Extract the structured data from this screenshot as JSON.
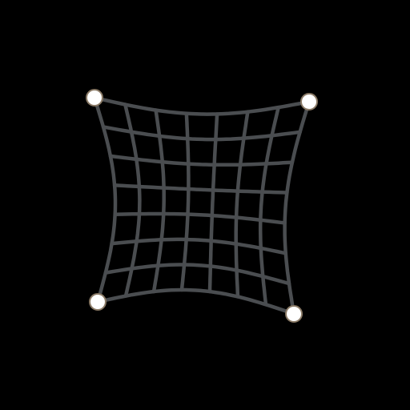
{
  "scene": {
    "background_color": "#000000",
    "mesh_color": "#4a4d50",
    "handle_fill": "#ffffff",
    "handle_stroke": "#8a7a66",
    "rows": 7,
    "cols": 7,
    "corner_handles": [
      "top-left",
      "top-right",
      "bottom-left",
      "bottom-right"
    ]
  }
}
